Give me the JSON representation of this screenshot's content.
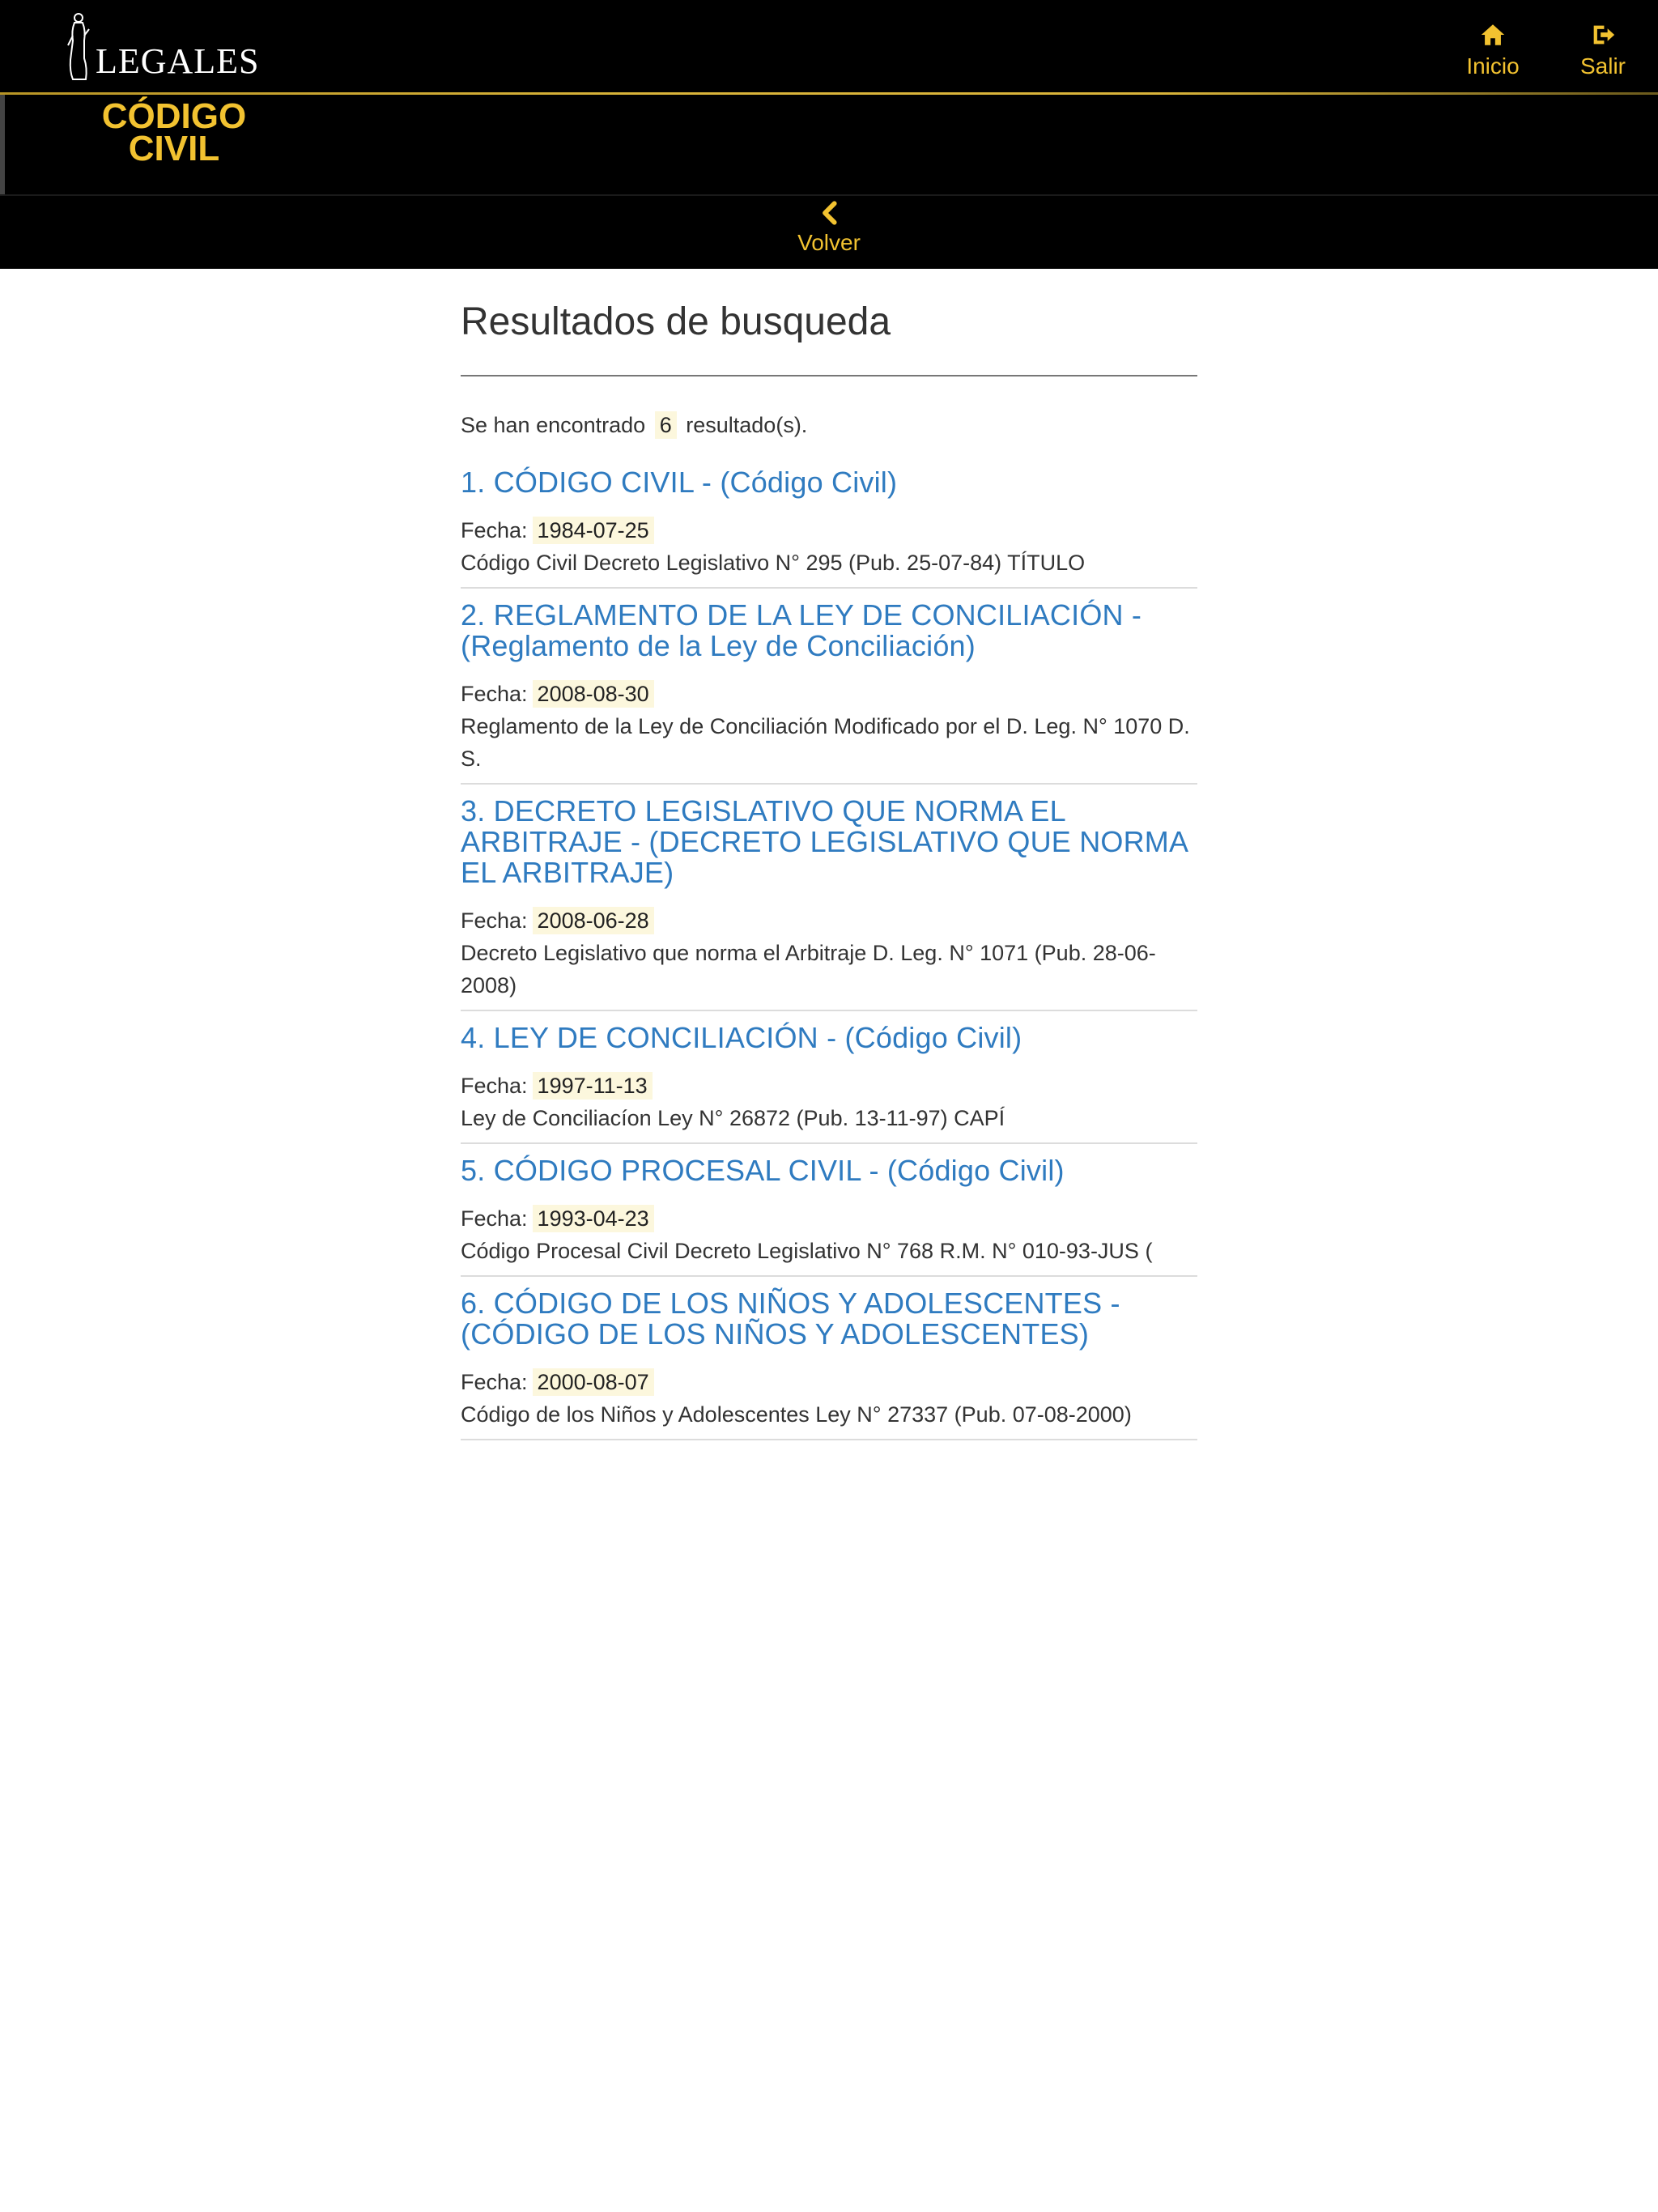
{
  "header": {
    "brand_name": "LEGALES",
    "app_title_line1": "CÓDIGO",
    "app_title_line2": "CIVIL",
    "nav": [
      {
        "label": "Inicio",
        "icon": "home-icon"
      },
      {
        "label": "Salir",
        "icon": "logout-icon"
      }
    ],
    "back_label": "Volver",
    "accent_color": "#f2c230"
  },
  "main": {
    "title": "Resultados de busqueda",
    "count_prefix": "Se han encontrado",
    "count": "6",
    "count_suffix": "resultado(s).",
    "date_label": "Fecha:",
    "link_color": "#2f7bc0",
    "results": [
      {
        "title": "1. CÓDIGO CIVIL - (Código Civil)",
        "date": "1984-07-25",
        "snippet": "Código Civil Decreto Legislativo N° 295 (Pub. 25-07-84) TÍTULO"
      },
      {
        "title": "2. REGLAMENTO DE LA LEY DE CONCILIACIÓN - (Reglamento de la Ley de Conciliación)",
        "date": "2008-08-30",
        "snippet": "Reglamento de la Ley de Conciliación Modificado por el D. Leg. N° 1070 D. S."
      },
      {
        "title": "3. DECRETO LEGISLATIVO QUE NORMA EL ARBITRAJE - (DECRETO LEGISLATIVO QUE NORMA EL ARBITRAJE)",
        "date": "2008-06-28",
        "snippet": "Decreto Legislativo que norma el Arbitraje D. Leg. N° 1071 (Pub. 28-06-2008)"
      },
      {
        "title": "4. LEY DE CONCILIACIÓN - (Código Civil)",
        "date": "1997-11-13",
        "snippet": "Ley de Conciliacíon Ley N° 26872 (Pub. 13-11-97) CAPÍ"
      },
      {
        "title": "5. CÓDIGO PROCESAL CIVIL - (Código Civil)",
        "date": "1993-04-23",
        "snippet": "Código Procesal Civil Decreto Legislativo N° 768 R.M. N° 010-93-JUS ("
      },
      {
        "title": "6. CÓDIGO DE LOS NIÑOS Y ADOLESCENTES - (CÓDIGO DE LOS NIÑOS Y ADOLESCENTES)",
        "date": "2000-08-07",
        "snippet": "Código de los Niños y Adolescentes Ley N° 27337 (Pub. 07-08-2000)"
      }
    ]
  }
}
